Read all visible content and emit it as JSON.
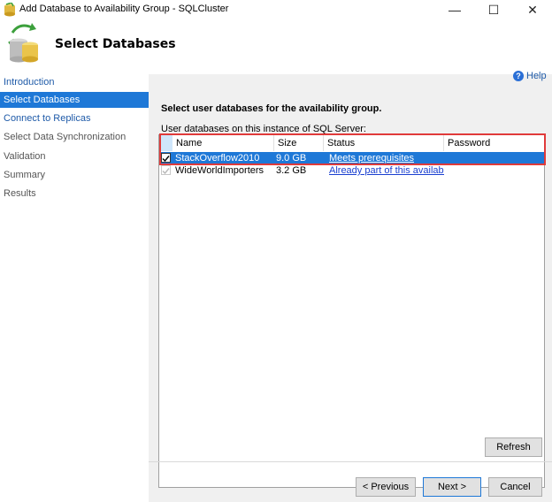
{
  "window": {
    "title": "Add Database to Availability Group - SQLCluster",
    "controls": {
      "minimize": "—",
      "maximize": "☐",
      "close": "✕"
    }
  },
  "header": {
    "title": "Select Databases"
  },
  "sidebar": {
    "items": [
      {
        "label": "Introduction",
        "state": "link"
      },
      {
        "label": "Select Databases",
        "state": "selected"
      },
      {
        "label": "Connect to Replicas",
        "state": "link"
      },
      {
        "label": "Select Data Synchronization",
        "state": "dim"
      },
      {
        "label": "Validation",
        "state": "dim"
      },
      {
        "label": "Summary",
        "state": "dim"
      },
      {
        "label": "Results",
        "state": "dim"
      }
    ]
  },
  "main": {
    "help": "Help",
    "instruction": "Select user databases for the availability group.",
    "list_label": "User databases on this instance of SQL Server:",
    "columns": {
      "name": "Name",
      "size": "Size",
      "status": "Status",
      "password": "Password"
    },
    "rows": [
      {
        "name": "StackOverflow2010",
        "size": "9.0 GB",
        "status": "Meets prerequisites",
        "checked": true,
        "selected": true
      },
      {
        "name": "WideWorldImporters",
        "size": "3.2 GB",
        "status": "Already part of this availabilit...",
        "checked": true,
        "selected": false
      }
    ],
    "buttons": {
      "refresh": "Refresh",
      "previous": "< Previous",
      "next": "Next >",
      "cancel": "Cancel"
    }
  },
  "colors": {
    "accent": "#1e78d7",
    "highlight": "#e03a3a",
    "link": "#1a3fd0"
  }
}
